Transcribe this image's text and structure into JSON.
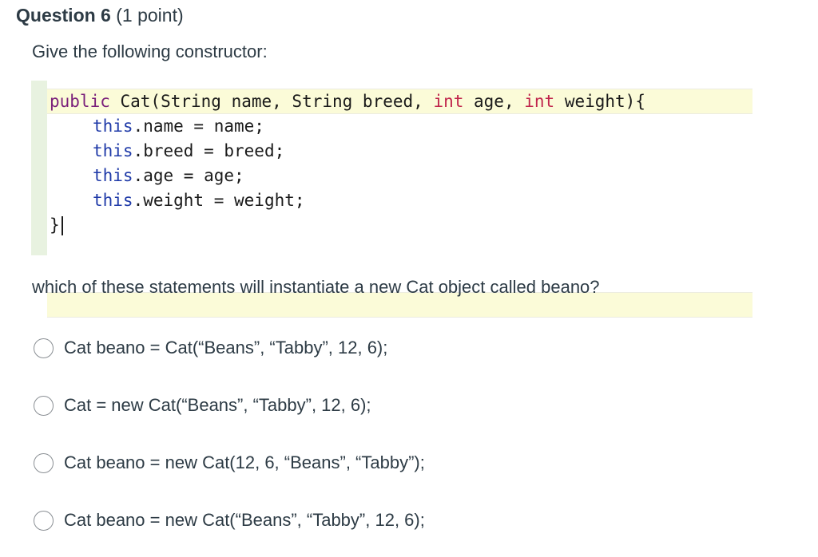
{
  "question": {
    "title": "Question 6",
    "points": "(1 point)",
    "prompt": "Give the following constructor:",
    "follow_up": "which of these statements will instantiate a new Cat object called beano?"
  },
  "code": {
    "line1": {
      "t1": "public",
      "t2": " Cat(String name, String breed, ",
      "t3": "int",
      "t4": " age, ",
      "t5": "int",
      "t6": " weight){"
    },
    "line2": {
      "kw": "this",
      "rest": ".name = name;"
    },
    "line3": {
      "kw": "this",
      "rest": ".breed = breed;"
    },
    "line4": {
      "kw": "this",
      "rest": ".age = age;"
    },
    "line5": {
      "kw": "this",
      "rest": ".weight = weight;"
    },
    "line6": "}"
  },
  "options": [
    {
      "label": "Cat beano =  Cat(“Beans”, “Tabby”, 12, 6);"
    },
    {
      "label": "Cat = new Cat(“Beans”, “Tabby”, 12, 6);"
    },
    {
      "label": "Cat beano = new Cat(12, 6, “Beans”, “Tabby”);"
    },
    {
      "label": "Cat beano = new Cat(“Beans”, “Tabby”, 12, 6);"
    }
  ],
  "colors": {
    "keyword_purple": "#7a1f7a",
    "keyword_blue": "#1f3aa8",
    "keyword_red": "#c0254c",
    "highlight": "#fbfbd8",
    "gutter": "#e8f2e0"
  }
}
